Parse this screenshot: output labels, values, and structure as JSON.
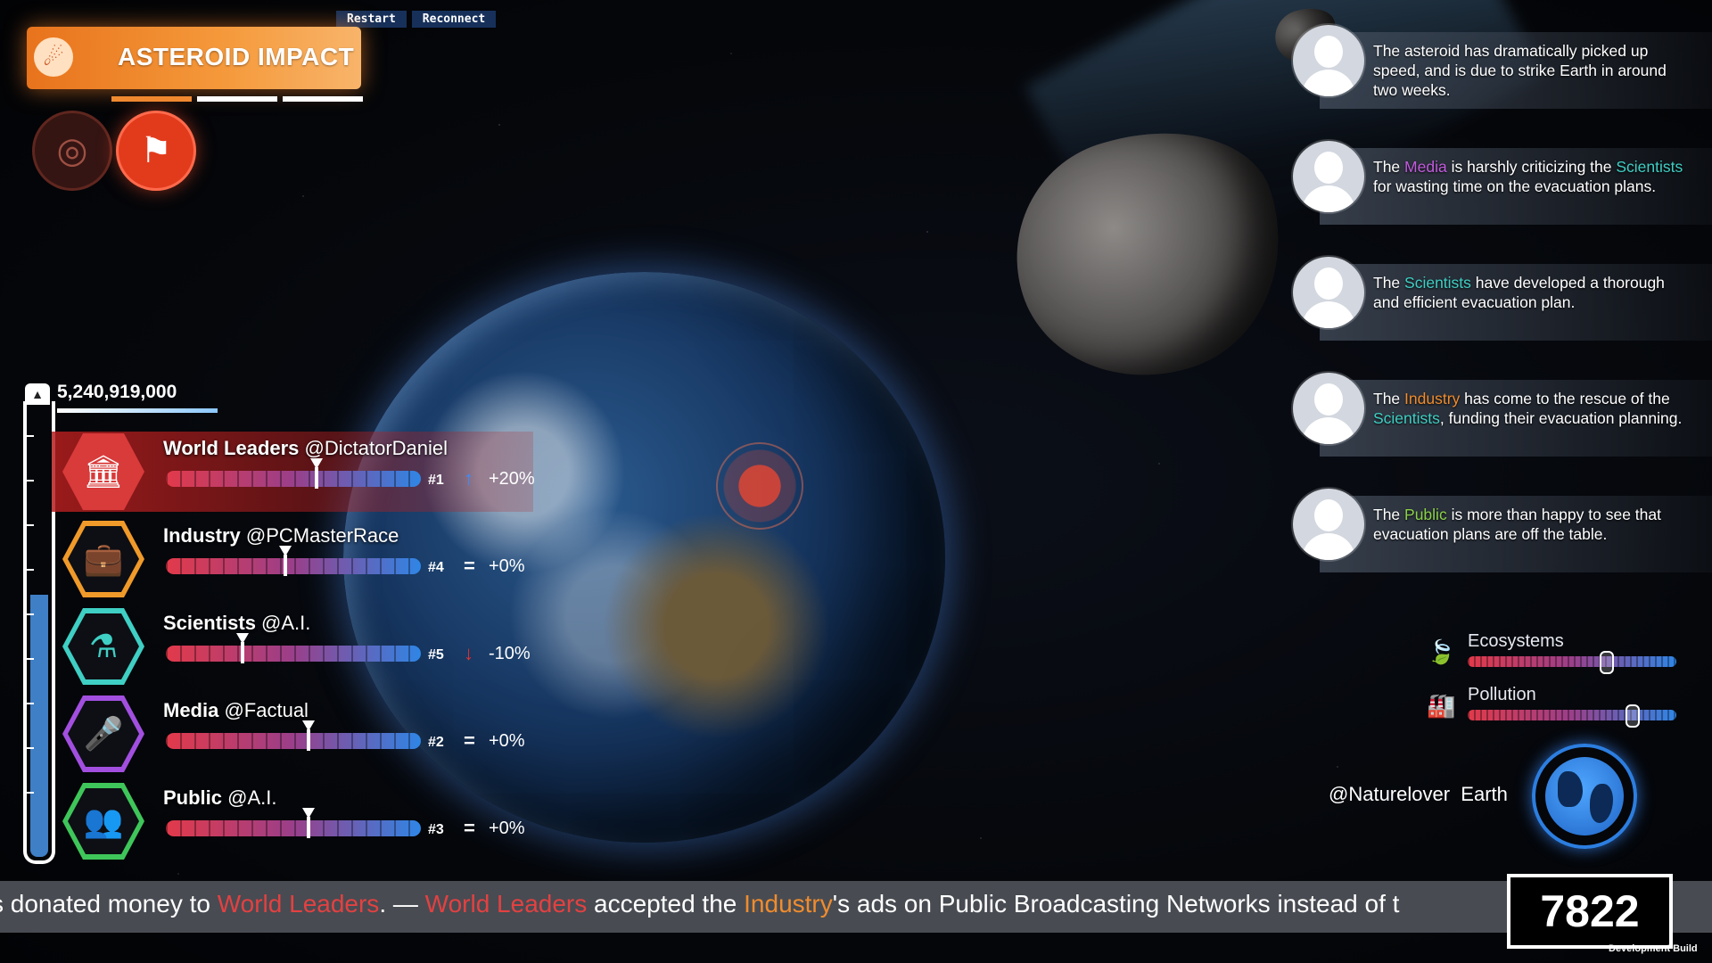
{
  "top_buttons": {
    "restart": "Restart",
    "reconnect": "Reconnect"
  },
  "scenario": {
    "title": "ASTEROID IMPACT",
    "progress_segments_filled": 1,
    "progress_segments_total": 3
  },
  "population": {
    "count": "5,240,919,000",
    "fill_fraction": 0.58
  },
  "factions": [
    {
      "name": "World Leaders",
      "handle": "@DictatorDaniel",
      "rank": "#1",
      "trend": "up",
      "change": "+20%",
      "slider_fraction": 0.59,
      "color": "#d93a3a",
      "icon": "government-icon",
      "highlight": true
    },
    {
      "name": "Industry",
      "handle": "@PCMasterRace",
      "rank": "#4",
      "trend": "equal",
      "change": "+0%",
      "slider_fraction": 0.47,
      "color": "#f09a2a",
      "icon": "briefcase-icon",
      "highlight": false
    },
    {
      "name": "Scientists",
      "handle": "@A.I.",
      "rank": "#5",
      "trend": "down",
      "change": "-10%",
      "slider_fraction": 0.3,
      "color": "#3fcfc4",
      "icon": "flask-icon",
      "highlight": false
    },
    {
      "name": "Media",
      "handle": "@Factual",
      "rank": "#2",
      "trend": "equal",
      "change": "+0%",
      "slider_fraction": 0.56,
      "color": "#a24fe0",
      "icon": "microphone-icon",
      "highlight": false
    },
    {
      "name": "Public",
      "handle": "@A.I.",
      "rank": "#3",
      "trend": "equal",
      "change": "+0%",
      "slider_fraction": 0.56,
      "color": "#3fc65a",
      "icon": "people-icon",
      "highlight": false
    }
  ],
  "feed": [
    {
      "parts": [
        {
          "t": "The asteroid has dramatically picked up speed, and is due to strike Earth in around two weeks."
        }
      ]
    },
    {
      "parts": [
        {
          "t": "The "
        },
        {
          "t": "Media",
          "c": "media"
        },
        {
          "t": " is harshly criticizing the "
        },
        {
          "t": "Scientists",
          "c": "sci"
        },
        {
          "t": " for wasting time on the evacuation plans."
        }
      ]
    },
    {
      "parts": [
        {
          "t": "The "
        },
        {
          "t": "Scientists",
          "c": "sci"
        },
        {
          "t": " have developed a thorough and efficient evacuation plan."
        }
      ]
    },
    {
      "parts": [
        {
          "t": "The "
        },
        {
          "t": "Industry",
          "c": "ind"
        },
        {
          "t": " has come to the rescue of the "
        },
        {
          "t": "Scientists",
          "c": "sci"
        },
        {
          "t": ", funding their evacuation planning."
        }
      ]
    },
    {
      "parts": [
        {
          "t": "The "
        },
        {
          "t": "Public",
          "c": "pub"
        },
        {
          "t": " is more than happy to see that evacuation plans are off the table."
        }
      ]
    }
  ],
  "environment": [
    {
      "label": "Ecosystems",
      "icon": "leaf-icon",
      "value_fraction": 0.66
    },
    {
      "label": "Pollution",
      "icon": "factory-icon",
      "value_fraction": 0.78
    }
  ],
  "earth_player": {
    "handle": "@Naturelover",
    "label": "Earth"
  },
  "ticker": {
    "parts": [
      {
        "t": "s donated money to "
      },
      {
        "t": "World Leaders",
        "c": "red"
      },
      {
        "t": ".  —  "
      },
      {
        "t": "World Leaders",
        "c": "red"
      },
      {
        "t": " accepted the "
      },
      {
        "t": "Industry",
        "c": "orange"
      },
      {
        "t": "'s ads on Public Broadcasting Networks instead of t"
      }
    ]
  },
  "score": "7822",
  "dev_label": "Development Build"
}
